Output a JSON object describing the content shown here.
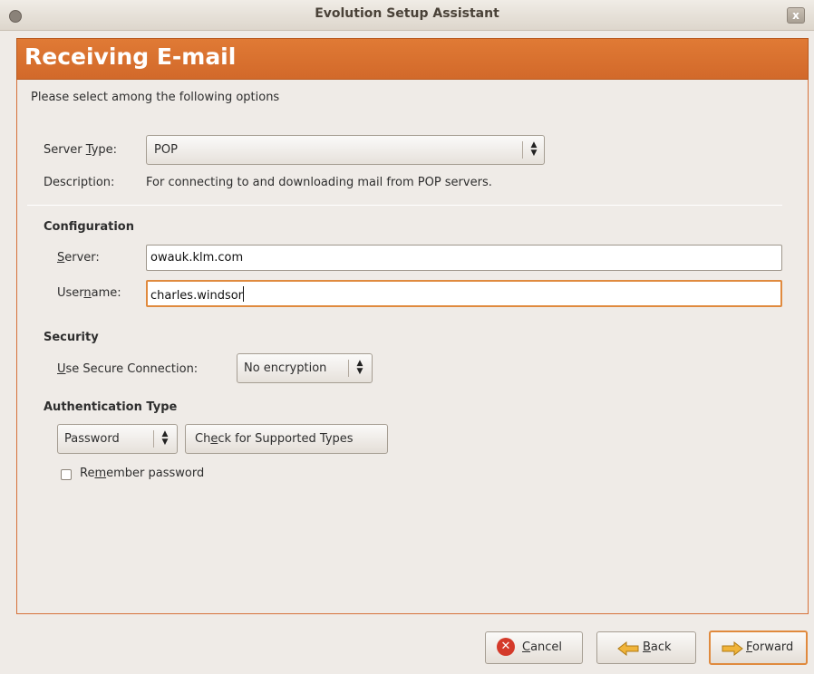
{
  "window": {
    "title": "Evolution Setup Assistant",
    "close_glyph": "x"
  },
  "header": {
    "title": "Receiving E-mail"
  },
  "intro": "Please select among the following options",
  "server_type": {
    "label_pre": "Server ",
    "label_mnemonic": "T",
    "label_post": "ype:",
    "value": "POP",
    "description_label": "Description:",
    "description": "For connecting to and downloading mail from POP servers."
  },
  "configuration": {
    "heading": "Configuration",
    "server_label_mnemonic": "S",
    "server_label_post": "erver:",
    "server_value": "owauk.klm.com",
    "username_label_pre": "User",
    "username_label_mnemonic": "n",
    "username_label_post": "ame:",
    "username_value": "charles.windsor"
  },
  "security": {
    "heading": "Security",
    "label_mnemonic": "U",
    "label_post": "se Secure Connection:",
    "value": "No encryption"
  },
  "authentication": {
    "heading": "Authentication Type",
    "value": "Password",
    "check_label_pre": "Ch",
    "check_label_mnemonic": "e",
    "check_label_post": "ck for Supported Types",
    "remember_pre": "Re",
    "remember_mnemonic": "m",
    "remember_post": "ember password",
    "remember_checked": false
  },
  "buttons": {
    "cancel_mnemonic": "C",
    "cancel_post": "ancel",
    "back_mnemonic": "B",
    "back_post": "ack",
    "forward_mnemonic": "F",
    "forward_post": "orward"
  },
  "icons": {
    "cancel": "cancel-icon",
    "back": "back-arrow-icon",
    "forward": "forward-arrow-icon",
    "combo": "spin-arrows-icon"
  },
  "colors": {
    "accent": "#d86f2f",
    "header_text": "#ffffff",
    "focus": "#e08a3e"
  }
}
